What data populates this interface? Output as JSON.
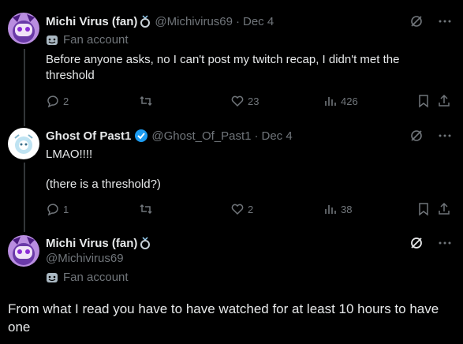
{
  "tweets": [
    {
      "name": "Michi Virus (fan)",
      "handle": "@Michivirus69",
      "dot": "·",
      "date": "Dec 4",
      "label": "Fan account",
      "text": "Before anyone asks, no I can't post my twitch recap, I didn't met the threshold",
      "replies": "2",
      "likes": "23",
      "views": "426"
    },
    {
      "name": "Ghost Of Past1",
      "handle": "@Ghost_Of_Past1",
      "dot": "·",
      "date": "Dec 4",
      "text_line1": "LMAO!!!!",
      "text_line2": "(there is a threshold?)",
      "replies": "1",
      "likes": "2",
      "views": "38"
    }
  ],
  "focus": {
    "name": "Michi Virus (fan)",
    "handle": "@Michivirus69",
    "label": "Fan account",
    "text": "From what I read you have to have watched for at least 10 hours to have one"
  },
  "colors": {
    "background": "#000000",
    "text": "#e7e9ea",
    "muted": "#71767b",
    "verified": "#1d9bf0"
  }
}
